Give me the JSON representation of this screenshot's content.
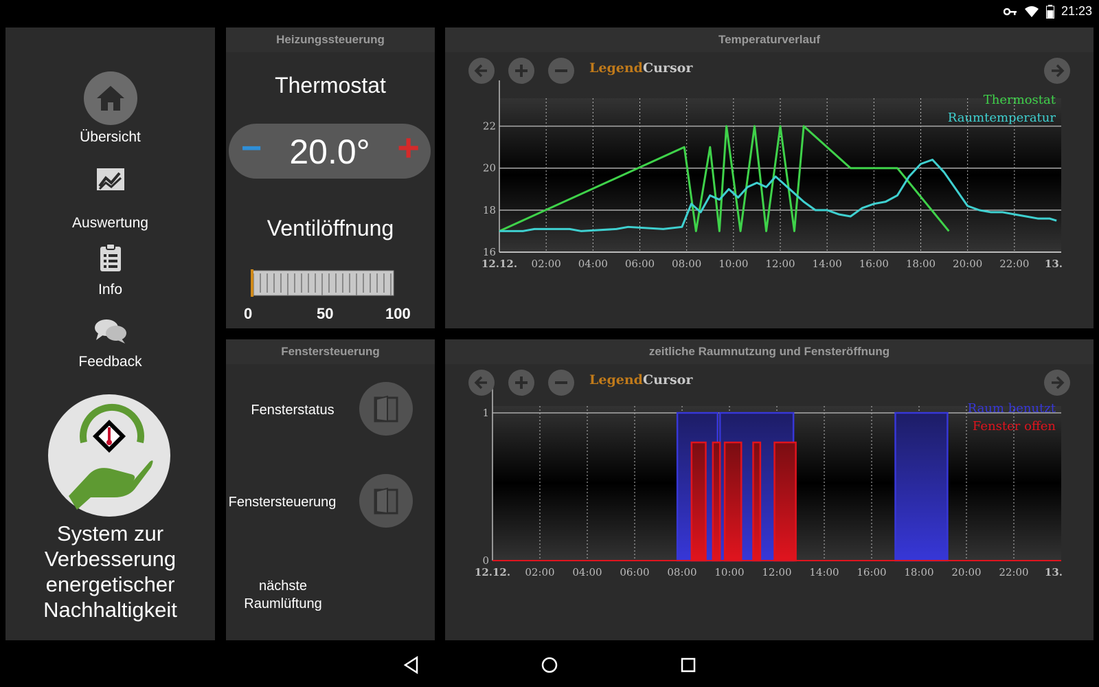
{
  "status_bar": {
    "time": "21:23",
    "icons": [
      "key-icon",
      "wifi-icon",
      "battery-icon"
    ]
  },
  "sidebar": {
    "items": [
      {
        "label": "Übersicht",
        "icon": "home-icon"
      },
      {
        "label": "Auswertung",
        "icon": "chart-icon"
      },
      {
        "label": "Info",
        "icon": "clipboard-icon"
      },
      {
        "label": "Feedback",
        "icon": "chat-icon"
      }
    ],
    "app_title": "System zur Verbesserung energetischer Nachhaltigkeit"
  },
  "heating": {
    "header": "Heizungssteuerung",
    "thermostat_label": "Thermostat",
    "thermostat_value": "20.0°",
    "minus_label": "−",
    "plus_label": "+",
    "valve_label": "Ventilöffnung",
    "valve_opening": 0,
    "valve_ticks": [
      "0",
      "50",
      "100"
    ]
  },
  "window_panel": {
    "header": "Fenstersteuerung",
    "status_label": "Fensterstatus",
    "control_label": "Fenstersteuerung",
    "next_vent_label_1": "nächste",
    "next_vent_label_2": "Raumlüftung"
  },
  "chart_temp": {
    "header": "Temperaturverlauf",
    "legend_label": "Legend",
    "cursor_label": "Cursor",
    "colors": {
      "legend": "#c07a1a",
      "cursor": "#c8c8c8"
    }
  },
  "chart_usage": {
    "header": "zeitliche Raumnutzung und Fensteröffnung",
    "legend_label": "Legend",
    "cursor_label": "Cursor"
  },
  "chart_data": [
    {
      "type": "line",
      "title": "Temperaturverlauf",
      "x_unit": "hours",
      "xlim": [
        0,
        24
      ],
      "ylim": [
        16,
        23
      ],
      "x_tick_labels": [
        "12.12.",
        "02:00",
        "04:00",
        "06:00",
        "08:00",
        "10:00",
        "12:00",
        "14:00",
        "16:00",
        "18:00",
        "20:00",
        "22:00",
        "13."
      ],
      "y_ticks": [
        16,
        18,
        20,
        22
      ],
      "grid": true,
      "legend_position": "top-right",
      "series": [
        {
          "name": "Thermostat",
          "color": "#3fd24a",
          "x": [
            0,
            7.9,
            8.4,
            9.0,
            9.4,
            9.7,
            10.3,
            10.9,
            11.4,
            12.0,
            12.6,
            13.0,
            15.0,
            17.0,
            19.2
          ],
          "y": [
            17,
            21,
            17,
            21,
            17,
            22,
            17,
            22,
            17,
            22,
            17,
            22,
            20,
            20,
            17
          ]
        },
        {
          "name": "Raumtemperatur",
          "color": "#3fd0d0",
          "x": [
            0,
            1.0,
            1.5,
            3.0,
            3.5,
            5.0,
            5.5,
            7.0,
            7.8,
            8.2,
            8.6,
            9.0,
            9.4,
            9.8,
            10.2,
            10.6,
            11.0,
            11.4,
            11.8,
            12.2,
            12.6,
            13.0,
            13.5,
            14.0,
            14.5,
            15.0,
            15.5,
            16.0,
            16.5,
            17.0,
            17.5,
            18.0,
            18.5,
            19.0,
            19.5,
            20.0,
            20.5,
            21.0,
            21.5,
            22.0,
            22.5,
            23.0,
            23.5,
            23.8
          ],
          "y": [
            17.0,
            17.0,
            17.1,
            17.1,
            17.0,
            17.1,
            17.2,
            17.1,
            17.2,
            18.3,
            17.9,
            18.7,
            18.5,
            19.0,
            18.6,
            19.1,
            19.3,
            19.1,
            19.6,
            19.2,
            18.8,
            18.4,
            18.0,
            18.0,
            17.8,
            17.7,
            18.1,
            18.3,
            18.4,
            18.7,
            19.6,
            20.2,
            20.4,
            19.8,
            19.0,
            18.2,
            18.0,
            17.9,
            17.9,
            17.8,
            17.7,
            17.6,
            17.6,
            17.5
          ]
        }
      ]
    },
    {
      "type": "area",
      "title": "zeitliche Raumnutzung und Fensteröffnung",
      "x_unit": "hours",
      "xlim": [
        0,
        24
      ],
      "ylim": [
        0,
        1
      ],
      "x_tick_labels": [
        "12.12.",
        "02:00",
        "04:00",
        "06:00",
        "08:00",
        "10:00",
        "12:00",
        "14:00",
        "16:00",
        "18:00",
        "20:00",
        "22:00",
        "13."
      ],
      "y_ticks": [
        0,
        1
      ],
      "grid": true,
      "legend_position": "top-right",
      "series": [
        {
          "name": "Raum benutzt",
          "color": "#3737d8",
          "intervals": [
            [
              7.8,
              9.5
            ],
            [
              9.6,
              12.7
            ],
            [
              17.0,
              19.2
            ]
          ],
          "level": 1
        },
        {
          "name": "Fenster offen",
          "color": "#e0141e",
          "intervals": [
            [
              8.4,
              9.0
            ],
            [
              9.3,
              9.6
            ],
            [
              9.8,
              10.5
            ],
            [
              11.0,
              11.3
            ],
            [
              11.9,
              12.8
            ]
          ],
          "level": 0.8
        }
      ]
    }
  ]
}
